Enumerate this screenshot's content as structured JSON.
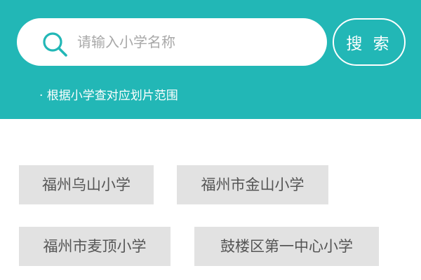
{
  "search": {
    "placeholder": "请输入小学名称",
    "button_label": "搜 索",
    "hint": "· 根据小学查对应划片范围"
  },
  "schools": [
    {
      "label": "福州乌山小学"
    },
    {
      "label": "福州市金山小学"
    },
    {
      "label": "福州市麦顶小学"
    },
    {
      "label": "鼓楼区第一中心小学"
    }
  ],
  "colors": {
    "header_bg": "#22b7b6",
    "tag_bg": "#e2e2e2",
    "tag_text": "#555555"
  }
}
